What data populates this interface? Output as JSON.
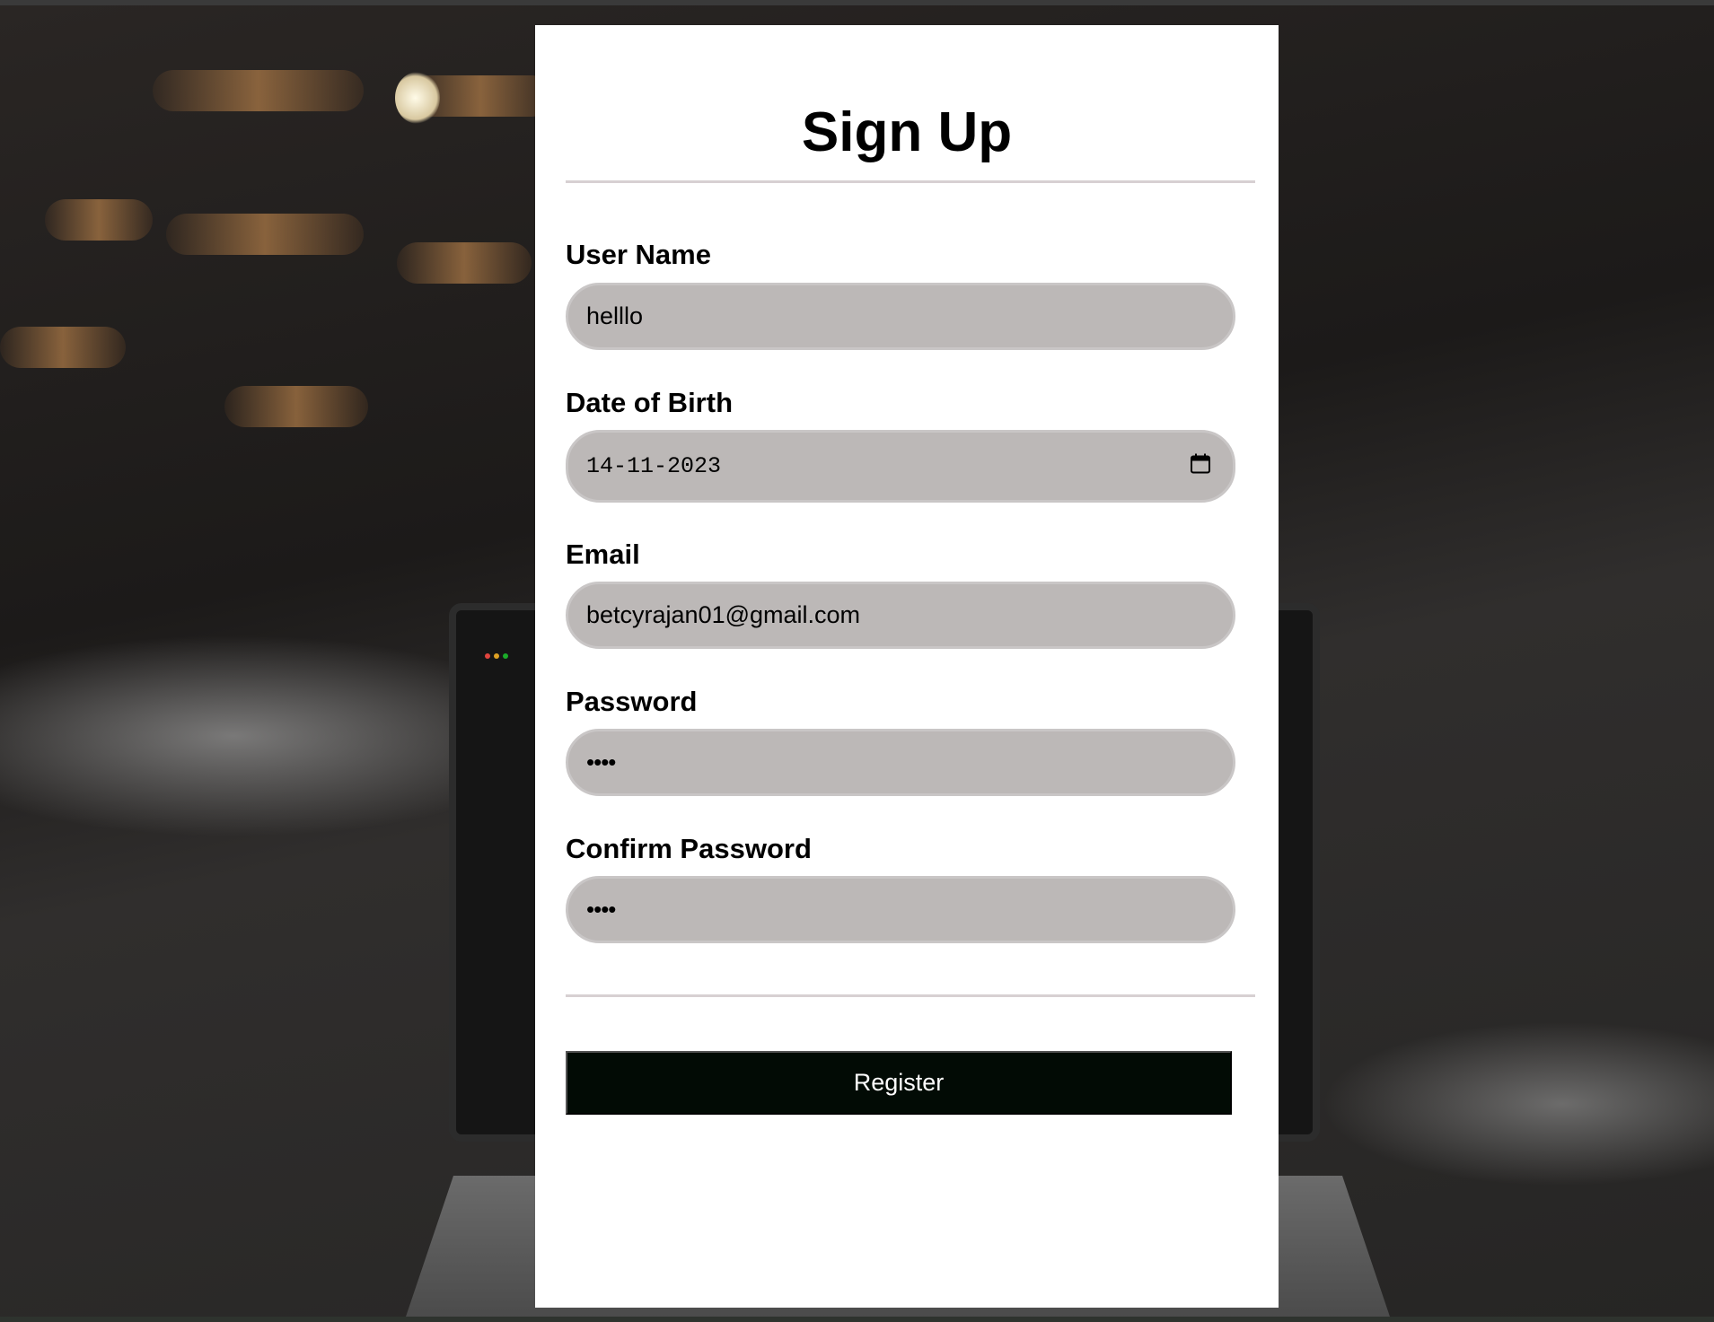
{
  "form": {
    "title": "Sign Up",
    "fields": [
      {
        "label": "User Name",
        "value": "helllo"
      },
      {
        "label": "Date of Birth",
        "value": "14-11-2023"
      },
      {
        "label": "Email",
        "value": "betcyrajan01@gmail.com"
      },
      {
        "label": "Password",
        "value": "••••"
      },
      {
        "label": "Confirm Password",
        "value": "••••"
      }
    ],
    "submit_label": "Register"
  },
  "icons": {
    "date_picker": "calendar-icon"
  },
  "colors": {
    "card_background": "#ffffff",
    "input_background": "#bcb8b7",
    "divider": "#d7d0d2",
    "button_background": "#020b05",
    "button_text": "#ffffff"
  }
}
